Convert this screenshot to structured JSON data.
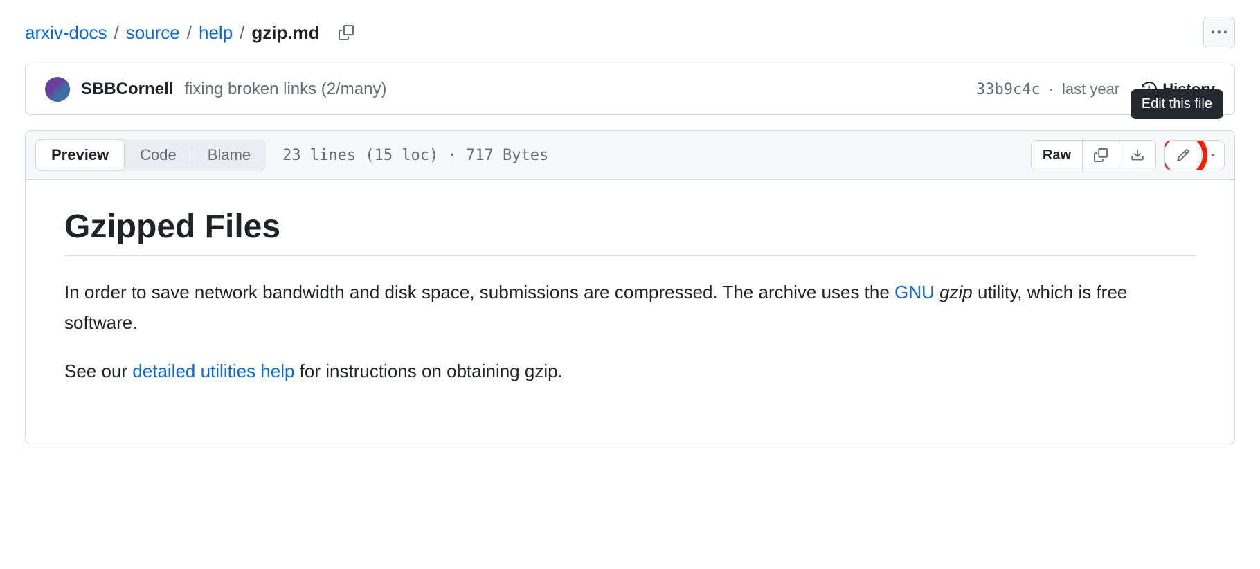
{
  "breadcrumb": {
    "parts": [
      "arxiv-docs",
      "source",
      "help"
    ],
    "current": "gzip.md"
  },
  "commit": {
    "author": "SBBCornell",
    "message": "fixing broken links (2/many)",
    "sha": "33b9c4c",
    "when": "last year",
    "history_label": "History"
  },
  "toolbar": {
    "tabs": {
      "preview": "Preview",
      "code": "Code",
      "blame": "Blame"
    },
    "meta": "23 lines (15 loc) · 717 Bytes",
    "raw": "Raw",
    "tooltip": "Edit this file"
  },
  "content": {
    "title": "Gzipped Files",
    "p1_a": "In order to save network bandwidth and disk space, submissions are compressed. The archive uses the ",
    "p1_link": "GNU",
    "p1_b": " ",
    "p1_em": "gzip",
    "p1_c": " utility, which is free software.",
    "p2_a": "See our ",
    "p2_link": "detailed utilities help",
    "p2_b": " for instructions on obtaining gzip."
  }
}
